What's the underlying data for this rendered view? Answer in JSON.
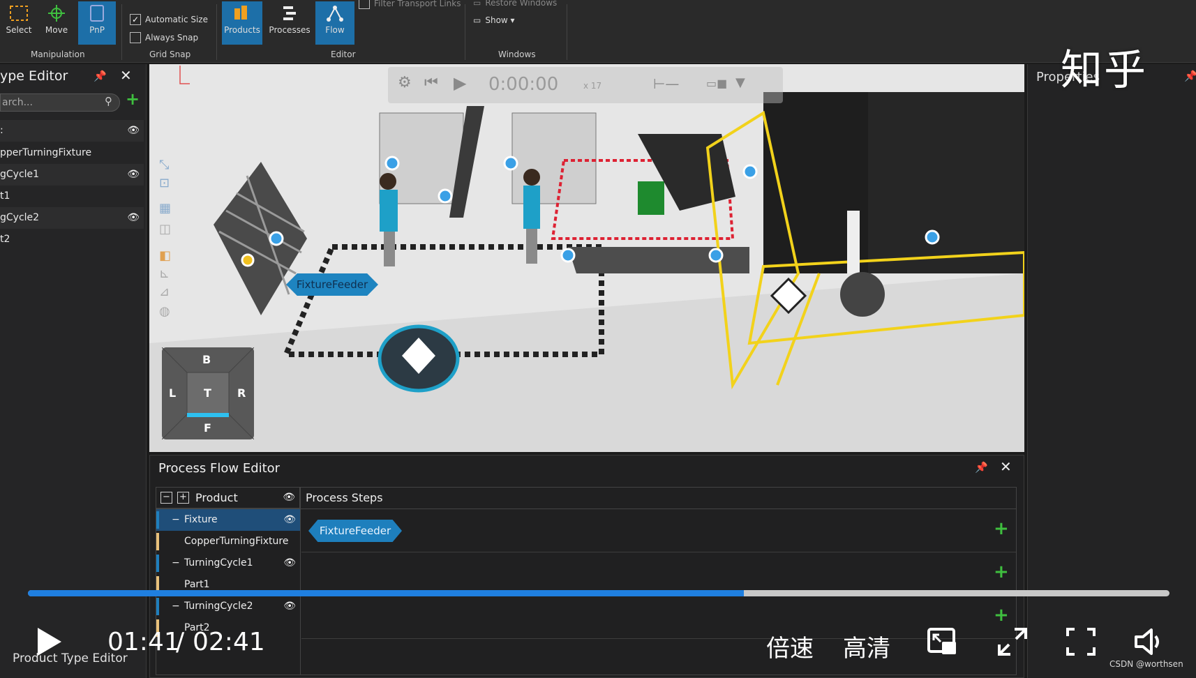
{
  "ribbon": {
    "manipulation": {
      "select_label": "Select",
      "move_label": "Move",
      "pnp_label": "PnP",
      "group_label": "Manipulation"
    },
    "grid_snap": {
      "automatic_size_label": "Automatic Size",
      "automatic_size_checked": true,
      "always_snap_label": "Always Snap",
      "always_snap_checked": false,
      "group_label": "Grid Snap"
    },
    "editor": {
      "products_label": "Products",
      "processes_label": "Processes",
      "flow_label": "Flow",
      "filter_label": "Filter Transport Links",
      "group_label": "Editor"
    },
    "windows": {
      "restore_label": "Restore Windows",
      "show_label": "Show ▾",
      "group_label": "Windows"
    }
  },
  "left_panel": {
    "title": "ype Editor",
    "search_placeholder": "arch...",
    "rows": [
      {
        "label": ":",
        "eye": true
      },
      {
        "label": "pperTurningFixture",
        "eye": false
      },
      {
        "label": "gCycle1",
        "eye": true
      },
      {
        "label": "t1",
        "eye": false
      },
      {
        "label": "gCycle2",
        "eye": true
      },
      {
        "label": "t2",
        "eye": false
      }
    ]
  },
  "viewport": {
    "anim_time": "0:00:00",
    "speed": "x 17",
    "feeder_tag": "FixtureFeeder",
    "navcube": {
      "top": "B",
      "left": "L",
      "center": "T",
      "right": "R",
      "bottom": "F"
    }
  },
  "right_panel": {
    "title": "Properties"
  },
  "watermark": "知乎",
  "process_flow_editor": {
    "title": "Process Flow Editor",
    "product_header": "Product",
    "steps_header": "Process Steps",
    "rows": [
      {
        "label": "Fixture",
        "prefix": "−",
        "eye": true,
        "selected": true
      },
      {
        "label": "CopperTurningFixture",
        "prefix": "",
        "eye": false,
        "selected": false
      },
      {
        "label": "TurningCycle1",
        "prefix": "−",
        "eye": true,
        "selected": false
      },
      {
        "label": "Part1",
        "prefix": "",
        "eye": false,
        "selected": false
      },
      {
        "label": "TurningCycle2",
        "prefix": "−",
        "eye": true,
        "selected": false
      },
      {
        "label": "Part2",
        "prefix": "",
        "eye": false,
        "selected": false
      }
    ],
    "step_tag": "FixtureFeeder"
  },
  "video": {
    "current_time": "01:41",
    "separator": "/",
    "total_time": "02:41",
    "progress_fraction": 0.627,
    "speed_label": "倍速",
    "quality_label": "高清",
    "credit": "CSDN @worthsen",
    "bottom_tab": "Product Type Editor"
  },
  "colors": {
    "accent_blue": "#1d6fa8",
    "progress_blue": "#1f7fe0",
    "add_green": "#3fbf3f",
    "fence_yellow": "#f2d21b"
  }
}
